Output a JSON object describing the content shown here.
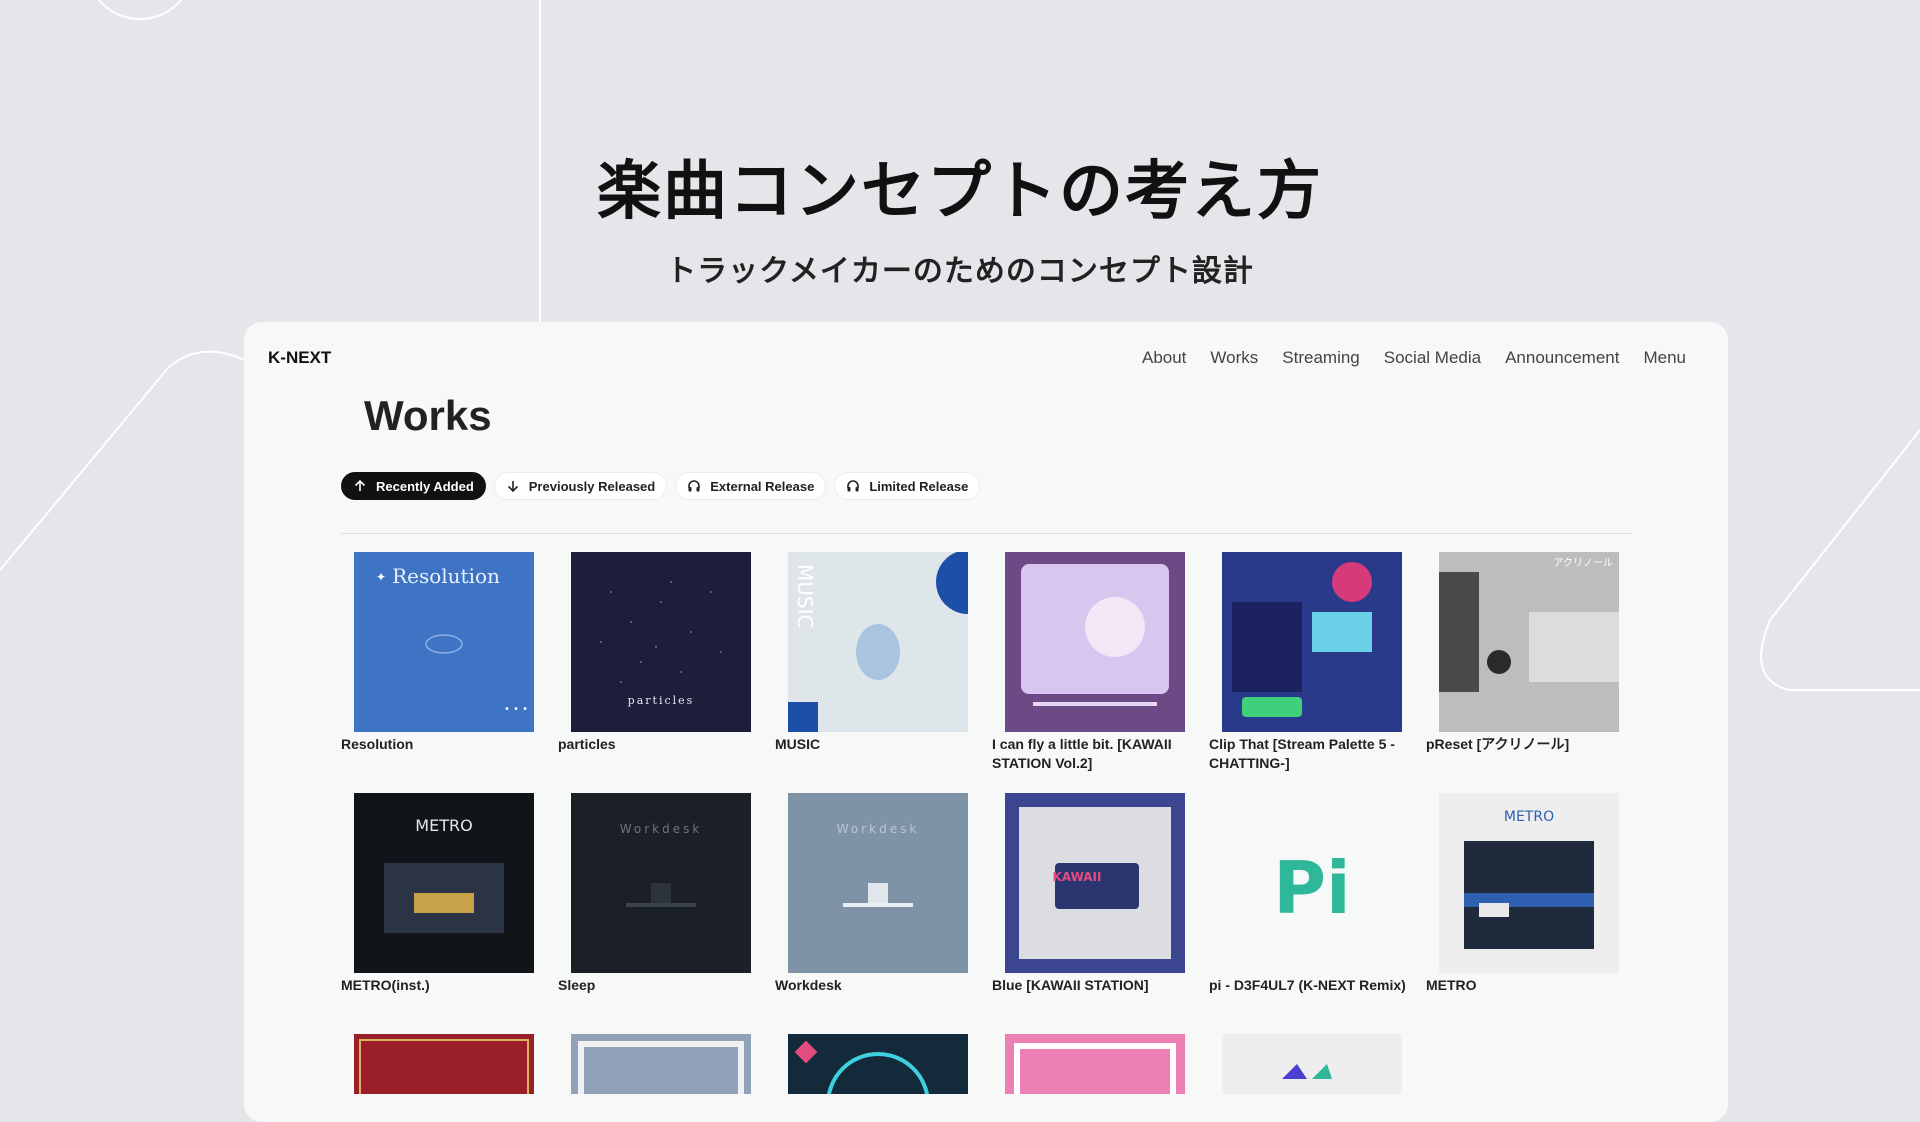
{
  "hero": {
    "title": "楽曲コンセプトの考え方",
    "subtitle": "トラックメイカーのためのコンセプト設計"
  },
  "site": {
    "brand": "K-NEXT",
    "nav": [
      "About",
      "Works",
      "Streaming",
      "Social Media",
      "Announcement",
      "Menu"
    ]
  },
  "page": {
    "title": "Works"
  },
  "filters": [
    {
      "label": "Recently Added",
      "icon": "arrow-up-icon",
      "active": true
    },
    {
      "label": "Previously Released",
      "icon": "arrow-down-icon",
      "active": false
    },
    {
      "label": "External Release",
      "icon": "headphones-icon",
      "active": false
    },
    {
      "label": "Limited Release",
      "icon": "headphones-icon",
      "active": false
    }
  ],
  "works": [
    {
      "title": "Resolution",
      "cover_text": "Resolution",
      "color": "#3f73c4"
    },
    {
      "title": "particles",
      "cover_text": "particles",
      "color": "#1d1f3a"
    },
    {
      "title": "MUSIC",
      "cover_text": "MUSIC",
      "color": "#dfe6ea"
    },
    {
      "title": "I can fly a little bit. [KAWAII STATION Vol.2]",
      "cover_text": "",
      "color": "#6b4a86"
    },
    {
      "title": "Clip That [Stream Palette 5 - CHATTING-]",
      "cover_text": "",
      "color": "#2a3a8a"
    },
    {
      "title": "pReset [アクリノール]",
      "cover_text": "アクリノール",
      "color": "#bdbdbd"
    },
    {
      "title": "METRO(inst.)",
      "cover_text": "METRO",
      "color": "#111418"
    },
    {
      "title": "Sleep",
      "cover_text": "Workdesk",
      "color": "#1b2026"
    },
    {
      "title": "Workdesk",
      "cover_text": "Workdesk",
      "color": "#7f93a6"
    },
    {
      "title": "Blue [KAWAII STATION]",
      "cover_text": "KAWAII",
      "color": "#3c4690"
    },
    {
      "title": "pi - D3F4UL7 (K-NEXT Remix)",
      "cover_text": "Pi",
      "color": "#f7f8f8"
    },
    {
      "title": "METRO",
      "cover_text": "METRO",
      "color": "#eeeeee"
    }
  ],
  "partial_row_colors": [
    "#9b1f2b",
    "#8fa2b8",
    "#132a3a",
    "#ec7fb3",
    "#eeeeee"
  ]
}
